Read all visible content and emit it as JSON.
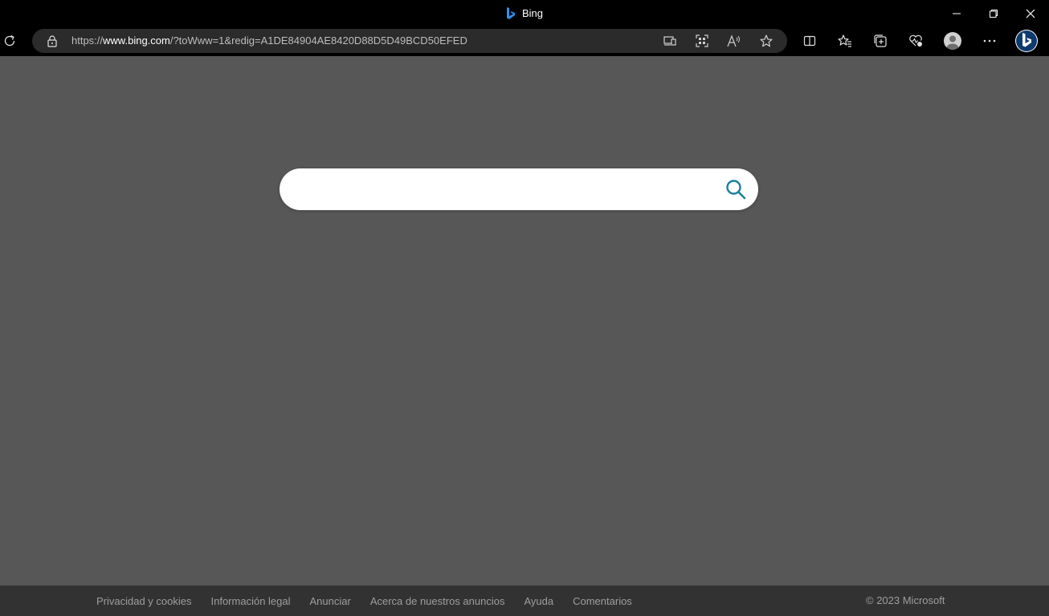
{
  "window": {
    "title": "Bing"
  },
  "address_bar": {
    "url_prefix": "https://",
    "url_host": "www.bing.com",
    "url_rest": "/?toWww=1&redig=A1DE84904AE8420D88D5D49BCD50EFED"
  },
  "toolbar_icons": [
    "refresh-icon",
    "lock-icon",
    "app-available-icon",
    "qr-code-icon",
    "read-aloud-icon",
    "favorite-star-icon",
    "split-screen-icon",
    "favorites-icon",
    "collections-icon",
    "browser-essentials-icon",
    "profile-icon",
    "more-icon",
    "bing-chat-icon"
  ],
  "search": {
    "value": "",
    "placeholder": ""
  },
  "footer": {
    "links": [
      "Privacidad y cookies",
      "Información legal",
      "Anunciar",
      "Acerca de nuestros anuncios",
      "Ayuda",
      "Comentarios"
    ],
    "copyright": "© 2023 Microsoft"
  },
  "colors": {
    "page_background": "#575757",
    "chrome_background": "#000000",
    "address_bar_background": "#2b2b2b",
    "footer_background": "#323232",
    "footer_text": "#9e9e9e",
    "search_icon": "#1a7f9c",
    "bing_blue": "#2f8ff0"
  }
}
